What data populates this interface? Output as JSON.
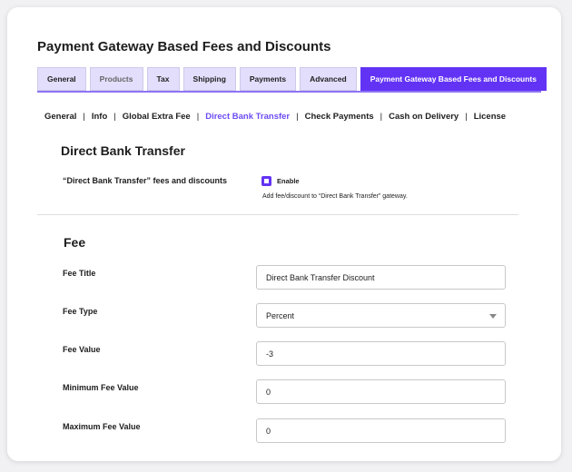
{
  "page_title": "Payment Gateway Based Fees and Discounts",
  "tabs": [
    "General",
    "Products",
    "Tax",
    "Shipping",
    "Payments",
    "Advanced",
    "Payment Gateway Based Fees and Discounts"
  ],
  "subnav": [
    "General",
    "Info",
    "Global Extra Fee",
    "Direct Bank Transfer",
    "Check Payments",
    "Cash on Delivery",
    "License"
  ],
  "section_title": "Direct Bank Transfer",
  "enable_row": {
    "label": "“Direct Bank Transfer” fees and discounts",
    "checkbox_label": "Enable",
    "checked": true,
    "description": "Add fee/discount to “Direct Bank Transfer” gateway."
  },
  "fee": {
    "title": "Fee",
    "fields": [
      {
        "label": "Fee Title",
        "value": "Direct Bank Transfer Discount"
      },
      {
        "label": "Fee Type",
        "value": "Percent"
      },
      {
        "label": "Fee Value",
        "value": "-3"
      },
      {
        "label": "Minimum Fee Value",
        "value": "0"
      },
      {
        "label": "Maximum Fee Value",
        "value": "0"
      }
    ]
  },
  "colors": {
    "accent": "#6333f5",
    "tab_bg": "#e3defc"
  }
}
